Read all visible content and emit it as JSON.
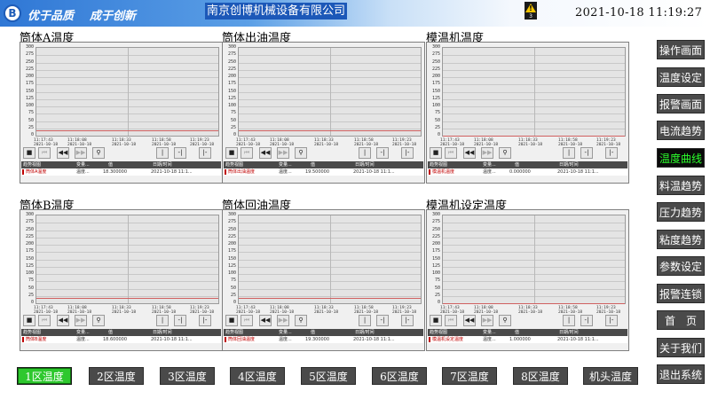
{
  "header": {
    "logo_letter": "B",
    "slogan_left": "优于品质",
    "slogan_right": "成于创新",
    "company": "南京创博机械设备有限公司",
    "alarm_icon": "warning-icon",
    "alarm_symbol": "!",
    "alarm_count": "3",
    "datetime": "2021-10-18  11:19:27"
  },
  "chart_data": [
    {
      "type": "line",
      "title": "筒体A温度",
      "ylim": [
        0,
        300
      ],
      "yticks": [
        0,
        25,
        50,
        75,
        100,
        125,
        150,
        175,
        200,
        225,
        250,
        275,
        300
      ],
      "x_labels": [
        [
          "11:17:43",
          "2021-10-18"
        ],
        [
          "11:18:08",
          "2021-10-18"
        ],
        [
          "11:18:33",
          "2021-10-18"
        ],
        [
          "11:18:58",
          "2021-10-18"
        ],
        [
          "11:19:23",
          "2021-10-18"
        ]
      ],
      "series": [
        {
          "name": "筒体A温度",
          "value": 18.3,
          "values": [
            18.3,
            18.3
          ]
        }
      ],
      "table": {
        "headers": [
          "趋势视图",
          "变量...",
          "值",
          "日期/时间"
        ],
        "row": {
          "name": "筒体A温度",
          "var": "温度...",
          "value": "18.300000",
          "datetime": "2021-10-18 11:1..."
        }
      }
    },
    {
      "type": "line",
      "title": "筒体出油温度",
      "ylim": [
        0,
        300
      ],
      "yticks": [
        0,
        25,
        50,
        75,
        100,
        125,
        150,
        175,
        200,
        225,
        250,
        275,
        300
      ],
      "x_labels": [
        [
          "11:17:43",
          "2021-10-18"
        ],
        [
          "11:18:08",
          "2021-10-18"
        ],
        [
          "11:18:33",
          "2021-10-18"
        ],
        [
          "11:18:58",
          "2021-10-18"
        ],
        [
          "11:19:23",
          "2021-10-18"
        ]
      ],
      "series": [
        {
          "name": "筒体出油温度",
          "value": 19.5,
          "values": [
            19.5,
            19.5
          ]
        }
      ],
      "table": {
        "headers": [
          "趋势视图",
          "变量...",
          "值",
          "日期/时间"
        ],
        "row": {
          "name": "筒体出油温度",
          "var": "温度...",
          "value": "19.500000",
          "datetime": "2021-10-18 11:1..."
        }
      }
    },
    {
      "type": "line",
      "title": "模温机温度",
      "ylim": [
        0,
        300
      ],
      "yticks": [
        0,
        25,
        50,
        75,
        100,
        125,
        150,
        175,
        200,
        225,
        250,
        275,
        300
      ],
      "x_labels": [
        [
          "11:17:43",
          "2021-10-18"
        ],
        [
          "11:18:08",
          "2021-10-18"
        ],
        [
          "11:18:33",
          "2021-10-18"
        ],
        [
          "11:18:58",
          "2021-10-18"
        ],
        [
          "11:19:23",
          "2021-10-18"
        ]
      ],
      "series": [
        {
          "name": "模温机温度",
          "value": 0.0,
          "values": [
            0.0,
            0.0
          ]
        }
      ],
      "table": {
        "headers": [
          "趋势视图",
          "变量...",
          "值",
          "日期/时间"
        ],
        "row": {
          "name": "模温机温度",
          "var": "温度...",
          "value": "0.000000",
          "datetime": "2021-10-18 11:1..."
        }
      }
    },
    {
      "type": "line",
      "title": "筒体B温度",
      "ylim": [
        0,
        300
      ],
      "yticks": [
        0,
        25,
        50,
        75,
        100,
        125,
        150,
        175,
        200,
        225,
        250,
        275,
        300
      ],
      "x_labels": [
        [
          "11:17:43",
          "2021-10-18"
        ],
        [
          "11:18:08",
          "2021-10-18"
        ],
        [
          "11:18:33",
          "2021-10-18"
        ],
        [
          "11:18:58",
          "2021-10-18"
        ],
        [
          "11:19:23",
          "2021-10-18"
        ]
      ],
      "series": [
        {
          "name": "筒体B温度",
          "value": 18.6,
          "values": [
            18.6,
            18.6
          ]
        }
      ],
      "table": {
        "headers": [
          "趋势视图",
          "变量...",
          "值",
          "日期/时间"
        ],
        "row": {
          "name": "筒体B温度",
          "var": "温度...",
          "value": "18.600000",
          "datetime": "2021-10-18 11:1..."
        }
      }
    },
    {
      "type": "line",
      "title": "筒体回油温度",
      "ylim": [
        0,
        300
      ],
      "yticks": [
        0,
        25,
        50,
        75,
        100,
        125,
        150,
        175,
        200,
        225,
        250,
        275,
        300
      ],
      "x_labels": [
        [
          "11:17:43",
          "2021-10-18"
        ],
        [
          "11:18:08",
          "2021-10-18"
        ],
        [
          "11:18:33",
          "2021-10-18"
        ],
        [
          "11:18:58",
          "2021-10-18"
        ],
        [
          "11:19:23",
          "2021-10-18"
        ]
      ],
      "series": [
        {
          "name": "筒体回油温度",
          "value": 19.3,
          "values": [
            19.3,
            19.3
          ]
        }
      ],
      "table": {
        "headers": [
          "趋势视图",
          "变量...",
          "值",
          "日期/时间"
        ],
        "row": {
          "name": "筒体回油温度",
          "var": "温度...",
          "value": "19.300000",
          "datetime": "2021-10-18 11:1..."
        }
      }
    },
    {
      "type": "line",
      "title": "模温机设定温度",
      "ylim": [
        0,
        300
      ],
      "yticks": [
        0,
        25,
        50,
        75,
        100,
        125,
        150,
        175,
        200,
        225,
        250,
        275,
        300
      ],
      "x_labels": [
        [
          "11:17:43",
          "2021-10-18"
        ],
        [
          "11:18:08",
          "2021-10-18"
        ],
        [
          "11:18:33",
          "2021-10-18"
        ],
        [
          "11:18:58",
          "2021-10-18"
        ],
        [
          "11:19:23",
          "2021-10-18"
        ]
      ],
      "series": [
        {
          "name": "模温机设定温度",
          "value": 1.0,
          "values": [
            1.0,
            1.0
          ]
        }
      ],
      "table": {
        "headers": [
          "趋势视图",
          "变量...",
          "值",
          "日期/时间"
        ],
        "row": {
          "name": "模温机设定温度",
          "var": "温度...",
          "value": "1.000000",
          "datetime": "2021-10-18 11:1..."
        }
      }
    }
  ],
  "toolbar_buttons": [
    {
      "icon": "stop-icon",
      "glyph": "■",
      "enabled": true
    },
    {
      "icon": "skip-back-icon",
      "glyph": "⏮",
      "enabled": false
    },
    {
      "icon": "rewind-icon",
      "glyph": "◀◀",
      "enabled": true
    },
    {
      "icon": "forward-icon",
      "glyph": "▶▶",
      "enabled": false
    },
    {
      "icon": "zoom-icon",
      "glyph": "⚲",
      "enabled": true
    },
    {
      "icon": "ruler-icon",
      "glyph": "|",
      "enabled": true
    },
    {
      "icon": "ruler-left-icon",
      "glyph": "-|",
      "enabled": true
    },
    {
      "icon": "ruler-right-icon",
      "glyph": "|-",
      "enabled": true
    }
  ],
  "sidebar": [
    {
      "label": "操作画面",
      "active": false
    },
    {
      "label": "温度设定",
      "active": false
    },
    {
      "label": "报警画面",
      "active": false
    },
    {
      "label": "电流趋势",
      "active": false
    },
    {
      "label": "温度曲线",
      "active": true
    },
    {
      "label": "料温趋势",
      "active": false
    },
    {
      "label": "压力趋势",
      "active": false
    },
    {
      "label": "粘度趋势",
      "active": false
    },
    {
      "label": "参数设定",
      "active": false
    },
    {
      "label": "报警连锁",
      "active": false
    },
    {
      "label": "首　页",
      "active": false
    },
    {
      "label": "关于我们",
      "active": false
    },
    {
      "label": "退出系统",
      "active": false
    }
  ],
  "zones": [
    {
      "label": "1区温度",
      "active": true
    },
    {
      "label": "2区温度",
      "active": false
    },
    {
      "label": "3区温度",
      "active": false
    },
    {
      "label": "4区温度",
      "active": false
    },
    {
      "label": "5区温度",
      "active": false
    },
    {
      "label": "6区温度",
      "active": false
    },
    {
      "label": "7区温度",
      "active": false
    },
    {
      "label": "8区温度",
      "active": false
    },
    {
      "label": "机头温度",
      "active": false
    }
  ],
  "colors": {
    "trend_line": "#d06060",
    "active_sidebar_text": "#2cff2c",
    "active_zone_bg": "#2ec82e"
  }
}
